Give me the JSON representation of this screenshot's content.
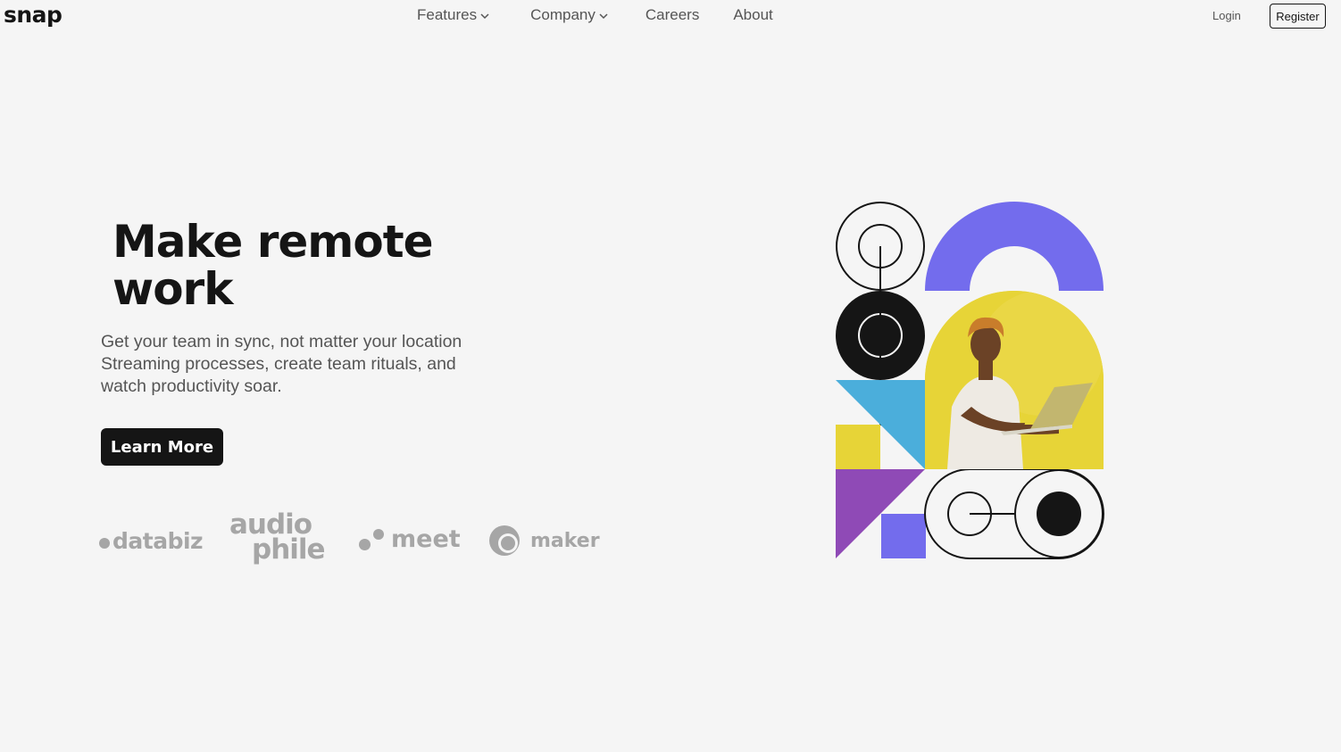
{
  "brand": {
    "logo": "snap"
  },
  "nav": {
    "items": [
      {
        "label": "Features",
        "has_dropdown": true
      },
      {
        "label": "Company",
        "has_dropdown": true
      },
      {
        "label": "Careers",
        "has_dropdown": false
      },
      {
        "label": "About",
        "has_dropdown": false
      }
    ],
    "login": "Login",
    "register": "Register"
  },
  "hero": {
    "title": "Make remote work",
    "text": "Get your team in sync, not matter your location Streaming processes, create team rituals, and watch productivity soar.",
    "cta": "Learn More"
  },
  "clients": {
    "databiz": "databiz",
    "audiophile_1": "audio",
    "audiophile_2": "phile",
    "meet": "meet",
    "maker": "maker"
  },
  "colors": {
    "background": "#f5f5f5",
    "text_dark": "#151515",
    "text_muted": "#555555",
    "logo_gray": "#a6a6a6",
    "accent_purple": "#736ced",
    "accent_yellow": "#e7d437",
    "accent_blue": "#4baedb",
    "accent_violet": "#8f4ab6"
  }
}
